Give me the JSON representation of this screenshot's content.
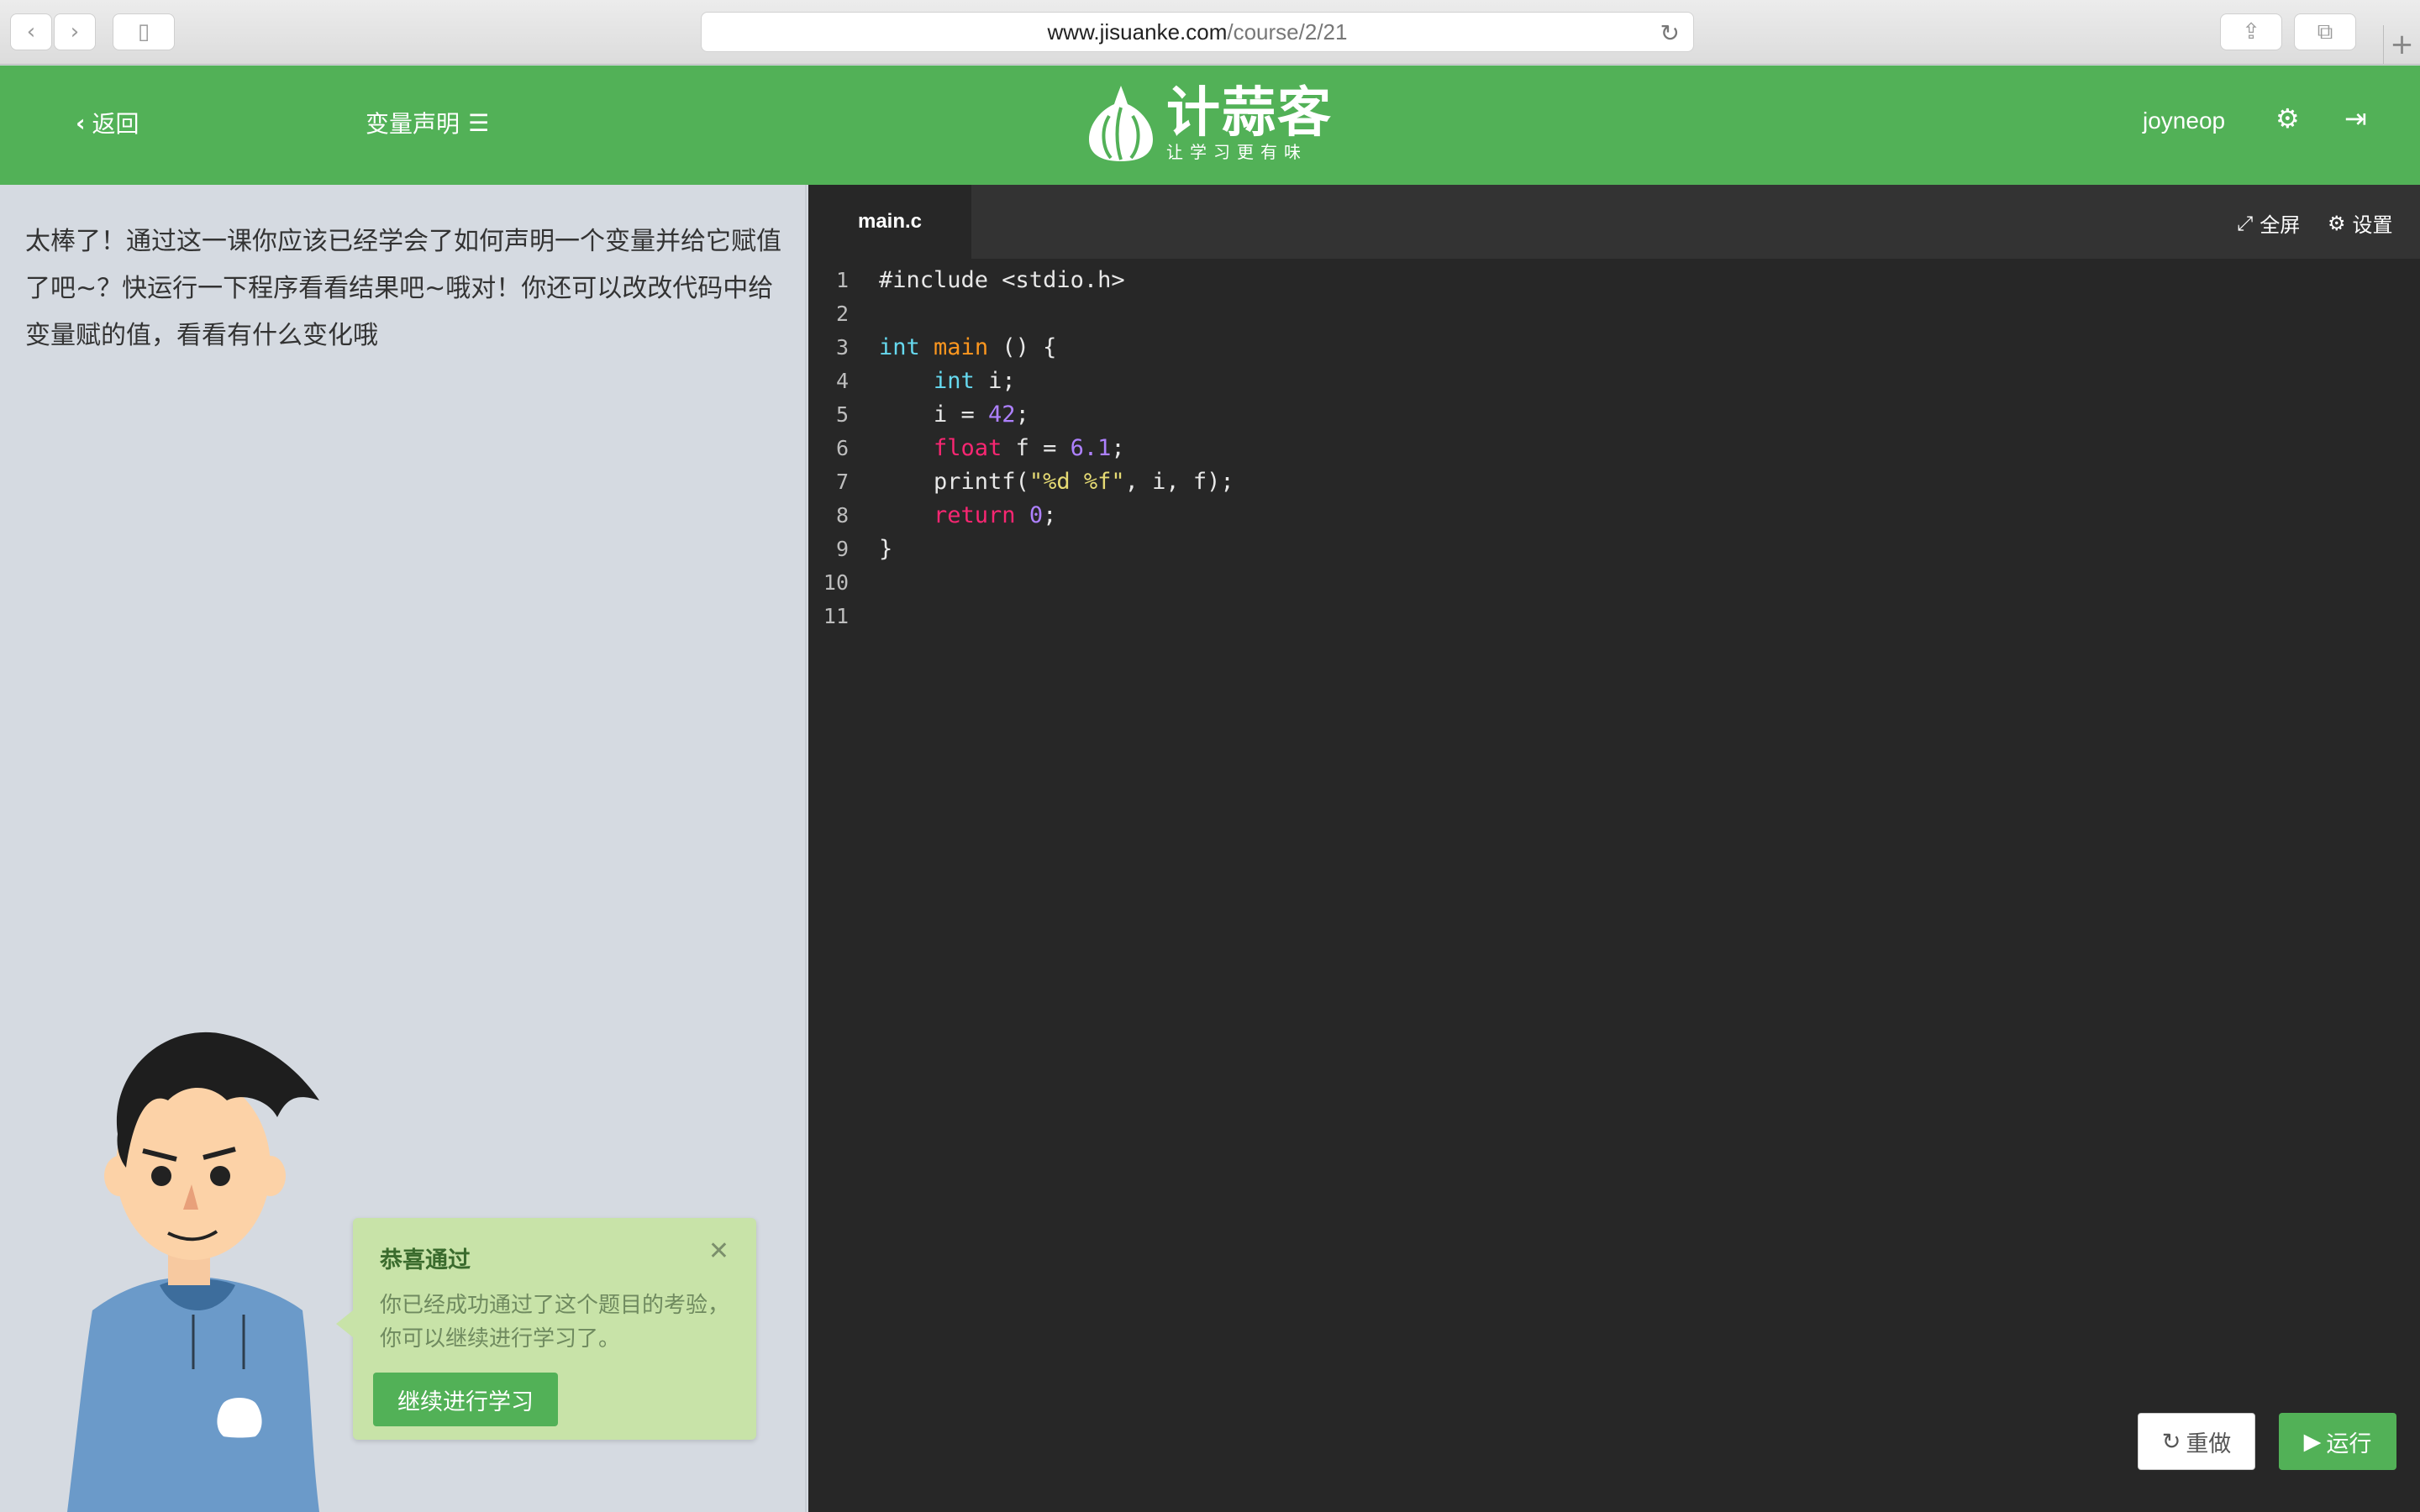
{
  "browser": {
    "url_host": "www.jisuanke.com",
    "url_path": "/course/2/21"
  },
  "header": {
    "back_label": "返回",
    "lesson_title": "变量声明",
    "logo_text": "计蒜客",
    "logo_slogan": "让学习更有味",
    "username": "joyneop"
  },
  "lesson": {
    "text": "太棒了！通过这一课你应该已经学会了如何声明一个变量并给它赋值了吧~？快运行一下程序看看结果吧~哦对！你还可以改改代码中给变量赋的值，看看有什么变化哦"
  },
  "popup": {
    "title": "恭喜通过",
    "body": "你已经成功通过了这个题目的考验，你可以继续进行学习了。",
    "button": "继续进行学习"
  },
  "editor": {
    "tab_name": "main.c",
    "fullscreen_label": "全屏",
    "settings_label": "设置",
    "redo_label": "重做",
    "run_label": "运行",
    "line_numbers": [
      "1",
      "2",
      "3",
      "4",
      "5",
      "6",
      "7",
      "8",
      "9",
      "10",
      "11"
    ],
    "code": {
      "l1": "#include <stdio.h>",
      "l3_type": "int",
      "l3_fn": "main",
      "l3_rest": " () {",
      "l4_indent": "    ",
      "l4_type": "int",
      "l4_rest": " i;",
      "l5_pre": "    i = ",
      "l5_num": "42",
      "l5_post": ";",
      "l6_indent": "    ",
      "l6_type": "float",
      "l6_mid": " f = ",
      "l6_num": "6.1",
      "l6_post": ";",
      "l7_pre": "    printf(",
      "l7_str": "\"%d %f\"",
      "l7_post": ", i, f);",
      "l8_indent": "    ",
      "l8_kw": "return",
      "l8_sp": " ",
      "l8_num": "0",
      "l8_post": ";",
      "l9": "}"
    }
  },
  "colors": {
    "brand_green": "#52b157",
    "editor_bg": "#272727",
    "panel_bg": "#d5dae1"
  }
}
